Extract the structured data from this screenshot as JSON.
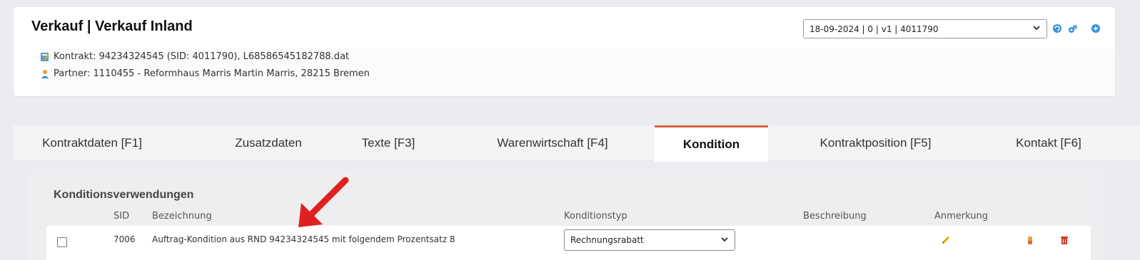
{
  "header": {
    "title": "Verkauf | Verkauf Inland",
    "contract_line": "Kontrakt: 94234324545 (SID: 4011790), L68586545182788.dat",
    "partner_line": "Partner: 1110455 - Reformhaus Marris Martin Marris, 28215 Bremen",
    "version_select": "18-09-2024 | 0 | v1 | 4011790"
  },
  "tabs": [
    {
      "label": "Kontraktdaten [F1]"
    },
    {
      "label": "Zusatzdaten"
    },
    {
      "label": "Texte [F3]"
    },
    {
      "label": "Warenwirtschaft [F4]"
    },
    {
      "label": "Kondition"
    },
    {
      "label": "Kontraktposition [F5]"
    },
    {
      "label": "Kontakt [F6]"
    }
  ],
  "active_tab": "Kondition",
  "section": {
    "title": "Konditionsverwendungen",
    "columns": {
      "sid": "SID",
      "bezeichnung": "Bezeichnung",
      "konditionstyp": "Konditionstyp",
      "beschreibung": "Beschreibung",
      "anmerkung": "Anmerkung"
    },
    "rows": [
      {
        "sid": "7006",
        "bezeichnung": "Auftrag-Kondition aus RND 94234324545 mit folgendem Prozentsatz 8",
        "konditionstyp": "Rechnungsrabatt",
        "beschreibung": ""
      }
    ]
  },
  "colors": {
    "accent": "#d9663f",
    "arrow": "#e02020",
    "delete": "#d23a2a"
  },
  "icons": [
    "contract-icon",
    "partner-icon",
    "refresh-icon",
    "settings-icon",
    "info-icon",
    "pencil-icon",
    "hand-icon",
    "trash-icon",
    "chevron-down-icon"
  ]
}
